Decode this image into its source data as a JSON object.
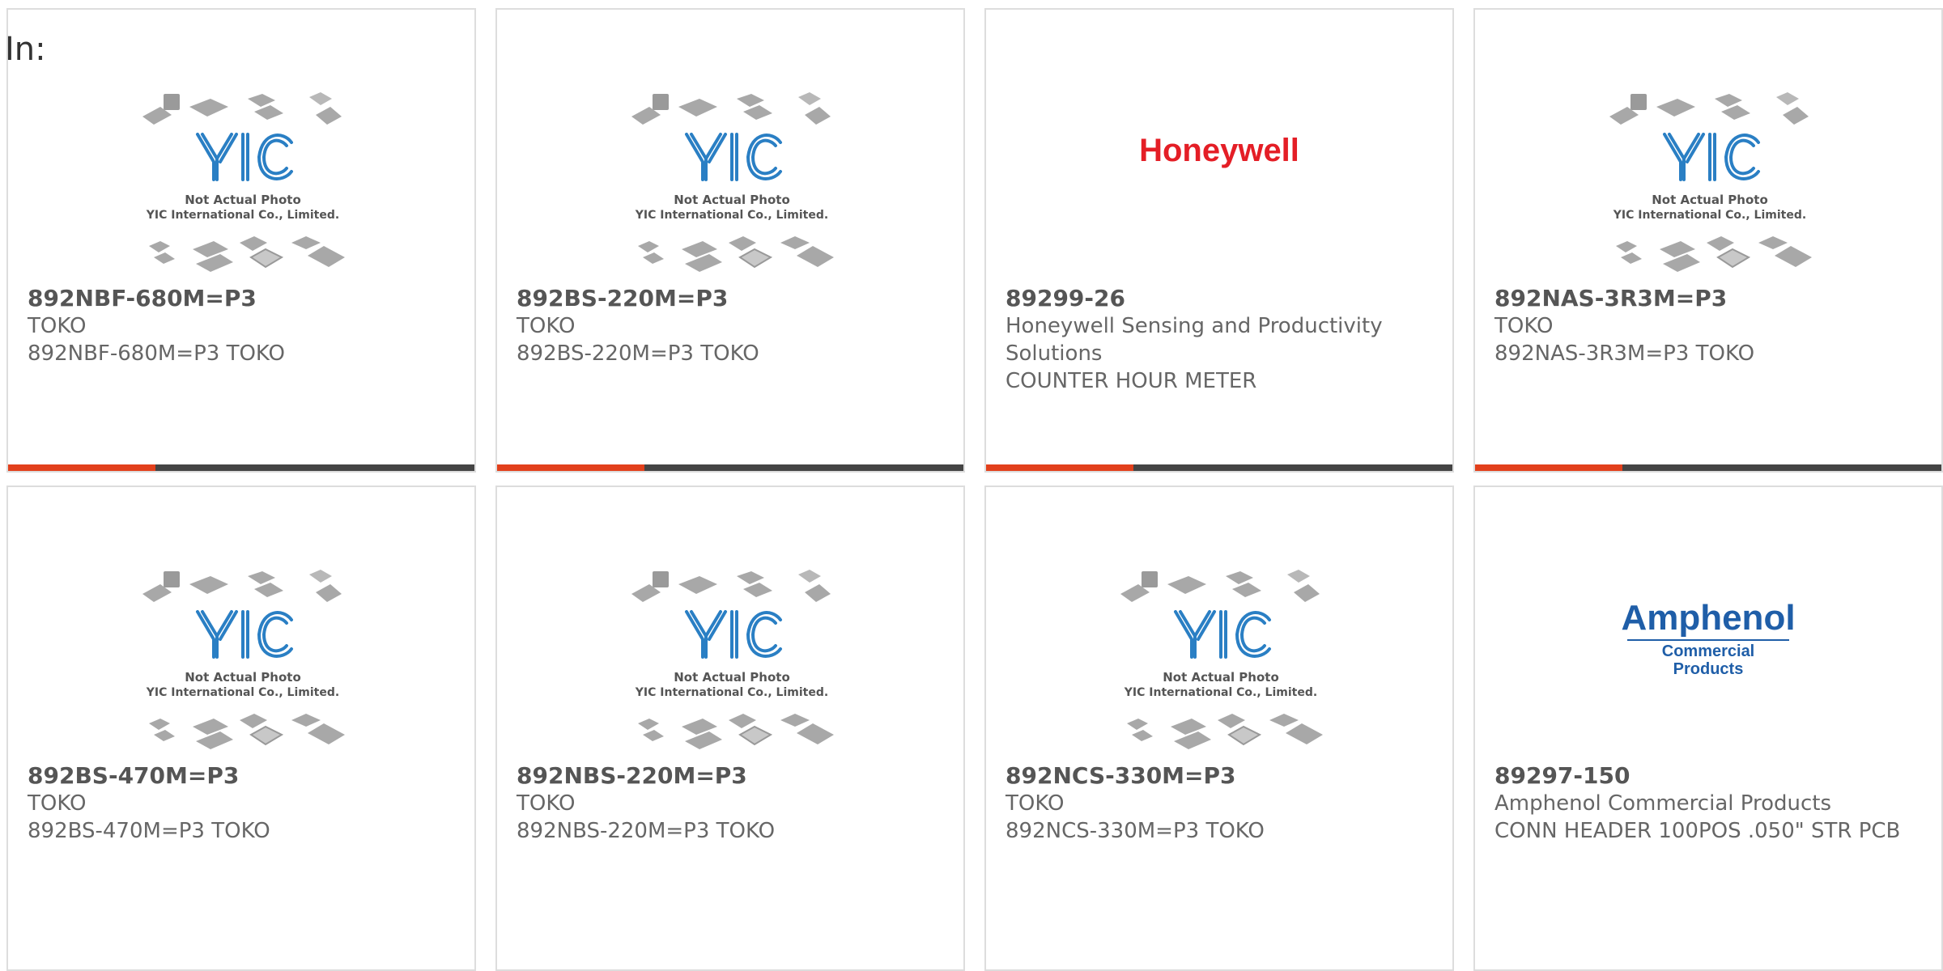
{
  "header": {
    "in_label": "In:"
  },
  "placeholder_text": {
    "line1": "Not Actual Photo",
    "line2": "YIC International Co., Limited.",
    "logo": "YIC"
  },
  "brand_logos": {
    "honeywell": "Honeywell",
    "amphenol_main": "Amphenol",
    "amphenol_sub": "Commercial Products"
  },
  "colors": {
    "accent": "#e2401c",
    "bar": "#444444",
    "yic_blue": "#2a7fc4",
    "honeywell_red": "#e41e26",
    "amphenol_blue": "#1f5ea8"
  },
  "products": [
    {
      "part_number": "892NBF-680M=P3",
      "manufacturer": "TOKO",
      "description": "892NBF-680M=P3 TOKO",
      "image": "placeholder"
    },
    {
      "part_number": "892BS-220M=P3",
      "manufacturer": "TOKO",
      "description": "892BS-220M=P3 TOKO",
      "image": "placeholder"
    },
    {
      "part_number": "89299-26",
      "manufacturer": "Honeywell Sensing and Productivity Solutions",
      "description": "COUNTER HOUR METER",
      "image": "honeywell-logo"
    },
    {
      "part_number": "892NAS-3R3M=P3",
      "manufacturer": "TOKO",
      "description": "892NAS-3R3M=P3 TOKO",
      "image": "placeholder"
    },
    {
      "part_number": "892BS-470M=P3",
      "manufacturer": "TOKO",
      "description": "892BS-470M=P3 TOKO",
      "image": "placeholder"
    },
    {
      "part_number": "892NBS-220M=P3",
      "manufacturer": "TOKO",
      "description": "892NBS-220M=P3 TOKO",
      "image": "placeholder"
    },
    {
      "part_number": "892NCS-330M=P3",
      "manufacturer": "TOKO",
      "description": "892NCS-330M=P3 TOKO",
      "image": "placeholder"
    },
    {
      "part_number": "89297-150",
      "manufacturer": "Amphenol Commercial Products",
      "description": "CONN HEADER 100POS .050\" STR PCB",
      "image": "amphenol-logo"
    }
  ]
}
